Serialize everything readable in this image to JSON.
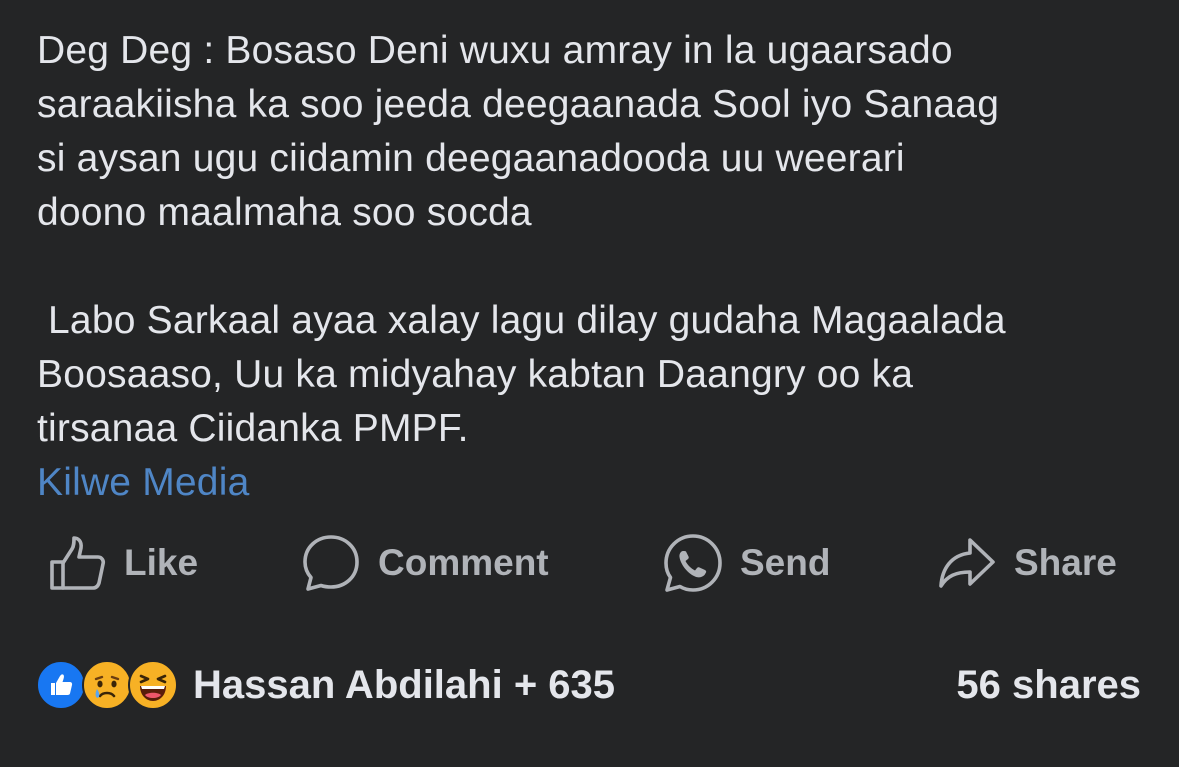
{
  "post": {
    "line_1": "Deg Deg : Bosaso Deni wuxu amray in la ugaarsado",
    "line_2": "saraakiisha ka soo jeeda deegaanada Sool iyo Sanaag",
    "line_3": "si aysan ugu ciidamin deegaanadooda uu weerari",
    "line_4": "doono maalmaha soo socda",
    "line_5": " Labo Sarkaal ayaa xalay lagu dilay gudaha Magaalada",
    "line_6": "Boosaaso, Uu ka midyahay kabtan Daangry oo ka",
    "line_7": "tirsanaa Ciidanka PMPF.",
    "page_link": "Kilwe Media",
    "link_color": "#4f86c6"
  },
  "actions": {
    "like_label": "Like",
    "like_icon": "thumbs-up-icon",
    "comment_label": "Comment",
    "comment_icon": "speech-bubble-icon",
    "send_label": "Send",
    "send_icon": "messenger-icon",
    "share_label": "Share",
    "share_icon": "share-arrow-icon"
  },
  "footer": {
    "reactions": [
      "like-reaction-icon",
      "sad-reaction-icon",
      "haha-reaction-icon"
    ],
    "reactors_text": "Hassan Abdilahi + 635",
    "shares_text": "56 shares"
  },
  "colors": {
    "background": "#242526",
    "primary_text": "#e4e6eb",
    "secondary_text": "#b0b3b8",
    "like_blue": "#1877f2",
    "reaction_yellow": "#f7b125"
  }
}
